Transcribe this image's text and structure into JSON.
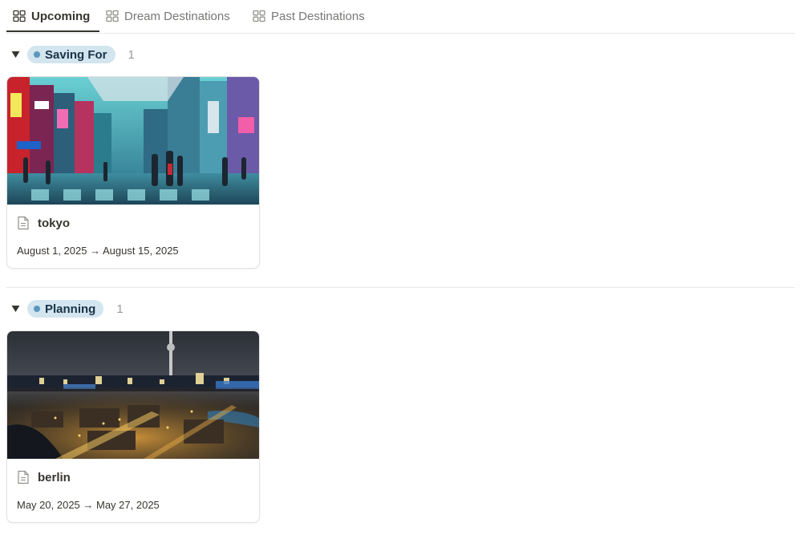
{
  "tabs": [
    {
      "label": "Upcoming",
      "icon": "gallery-grid-icon",
      "active": true
    },
    {
      "label": "Dream Destinations",
      "icon": "gallery-grid-icon",
      "active": false
    },
    {
      "label": "Past Destinations",
      "icon": "gallery-grid-icon",
      "active": false
    }
  ],
  "groups": [
    {
      "name": "Saving For",
      "count": "1",
      "pill_color": "#d3e5ef",
      "dot_color": "#5b97bd",
      "cards": [
        {
          "title": "tokyo",
          "dates": "August 1, 2025 → August 15, 2025",
          "cover": "tokyo-night-street-photo"
        }
      ]
    },
    {
      "name": "Planning",
      "count": "1",
      "pill_color": "#d3e5ef",
      "dot_color": "#5b97bd",
      "cards": [
        {
          "title": "berlin",
          "dates": "May 20, 2025 → May 27, 2025",
          "cover": "berlin-night-skyline-photo"
        }
      ]
    }
  ]
}
